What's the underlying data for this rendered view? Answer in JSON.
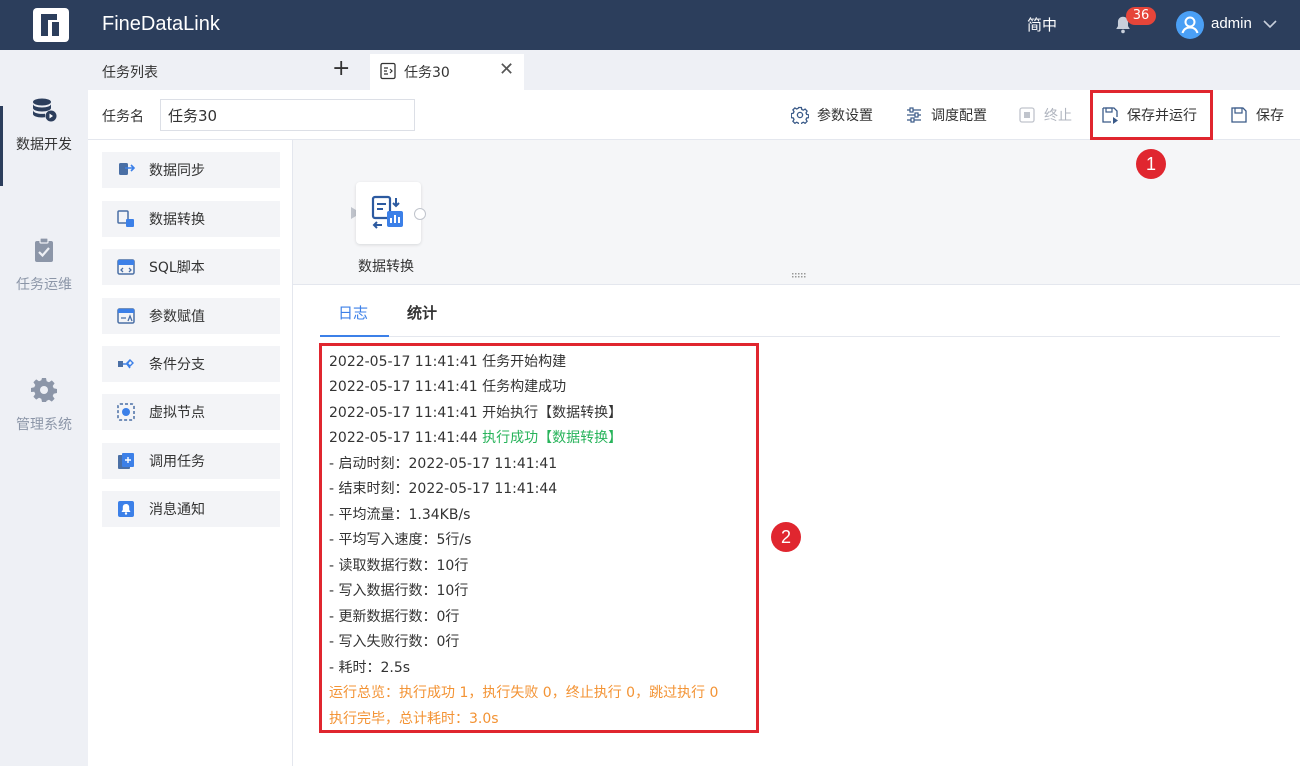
{
  "app": {
    "name": "FineDataLink",
    "language": "简中",
    "notifications": "36",
    "user": "admin"
  },
  "rail": [
    {
      "label": "数据开发",
      "icon": "database-run-icon",
      "active": true
    },
    {
      "label": "任务运维",
      "icon": "clipboard-check-icon",
      "active": false
    },
    {
      "label": "管理系统",
      "icon": "gear-icon",
      "active": false
    }
  ],
  "tabs": {
    "list_label": "任务列表",
    "add": "+",
    "active_task": "任务30",
    "close": "✕"
  },
  "toolbar": {
    "task_name_label": "任务名",
    "task_name_value": "任务30",
    "param_settings": "参数设置",
    "schedule_config": "调度配置",
    "stop": "终止",
    "save_run": "保存并运行",
    "save": "保存"
  },
  "palette": [
    "数据同步",
    "数据转换",
    "SQL脚本",
    "参数赋值",
    "条件分支",
    "虚拟节点",
    "调用任务",
    "消息通知"
  ],
  "canvas": {
    "node_label": "数据转换"
  },
  "log_tabs": {
    "log": "日志",
    "stats": "统计"
  },
  "log": {
    "l1": "2022-05-17 11:41:41 任务开始构建",
    "l2": "2022-05-17 11:41:41 任务构建成功",
    "l3": "2022-05-17 11:41:41 开始执行【数据转换】",
    "l4a": "2022-05-17 11:41:44 ",
    "l4b": "执行成功【数据转换】",
    "l5": "- 启动时刻：2022-05-17 11:41:41",
    "l6": "- 结束时刻：2022-05-17 11:41:44",
    "l7": "- 平均流量：1.34KB/s",
    "l8": "- 平均写入速度：5行/s",
    "l9": "- 读取数据行数：10行",
    "l10": "- 写入数据行数：10行",
    "l11": "- 更新数据行数：0行",
    "l12": "- 写入失败行数：0行",
    "l13": "- 耗时：2.5s",
    "l14": "运行总览：执行成功 1，执行失败 0，终止执行 0，跳过执行 0",
    "l15": "执行完毕，总计耗时：3.0s"
  },
  "markers": {
    "m1": "1",
    "m2": "2"
  },
  "colors": {
    "topbar": "#2c3e5c",
    "accent": "#3c80e8",
    "highlight": "#e0262f",
    "success": "#27b35a",
    "warning": "#f39334"
  }
}
